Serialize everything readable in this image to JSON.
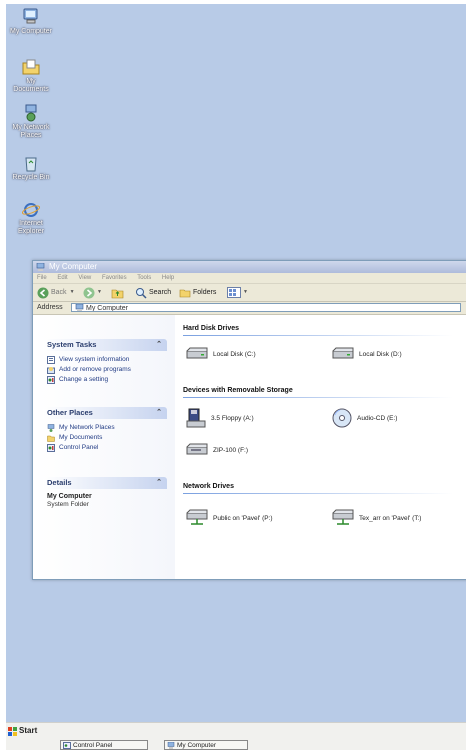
{
  "desktop": {
    "icons": [
      {
        "label": "My Computer",
        "icon": "my-computer-icon"
      },
      {
        "label": "My Documents",
        "icon": "my-documents-icon"
      },
      {
        "label": "My Network Places",
        "icon": "network-places-icon"
      },
      {
        "label": "Recycle Bin",
        "icon": "recycle-bin-icon"
      },
      {
        "label": "Internet Explorer",
        "icon": "internet-explorer-icon"
      }
    ]
  },
  "window": {
    "title": "My Computer",
    "menu": [
      "File",
      "Edit",
      "View",
      "Favorites",
      "Tools",
      "Help"
    ],
    "toolbar": {
      "back": "Back",
      "search": "Search",
      "folders": "Folders"
    },
    "address_label": "Address",
    "address_value": "My Computer"
  },
  "taskpane": {
    "system_tasks": {
      "title": "System Tasks",
      "items": [
        "View system information",
        "Add or remove programs",
        "Change a setting"
      ]
    },
    "other_places": {
      "title": "Other Places",
      "items": [
        "My Network Places",
        "My Documents",
        "Control Panel"
      ]
    },
    "details": {
      "title": "Details",
      "name": "My Computer",
      "type": "System Folder"
    }
  },
  "main": {
    "groups": [
      {
        "title": "Hard Disk Drives",
        "items": [
          "Local Disk (C:)",
          "Local Disk (D:)"
        ]
      },
      {
        "title": "Devices with Removable Storage",
        "items": [
          "3.5 Floppy (A:)",
          "Audio-CD (E:)",
          "ZIP-100 (F:)"
        ]
      },
      {
        "title": "Network Drives",
        "items": [
          "Public on 'Pavel' (P:)",
          "Tex_arr on 'Pavel' (T:)"
        ]
      }
    ]
  },
  "taskbar": {
    "start": "Start",
    "buttons": [
      "Control Panel",
      "My Computer"
    ]
  },
  "colors": {
    "desktop": "#b8cbe7",
    "accent": "#213b84",
    "panel_head": "#c6d3ef"
  }
}
